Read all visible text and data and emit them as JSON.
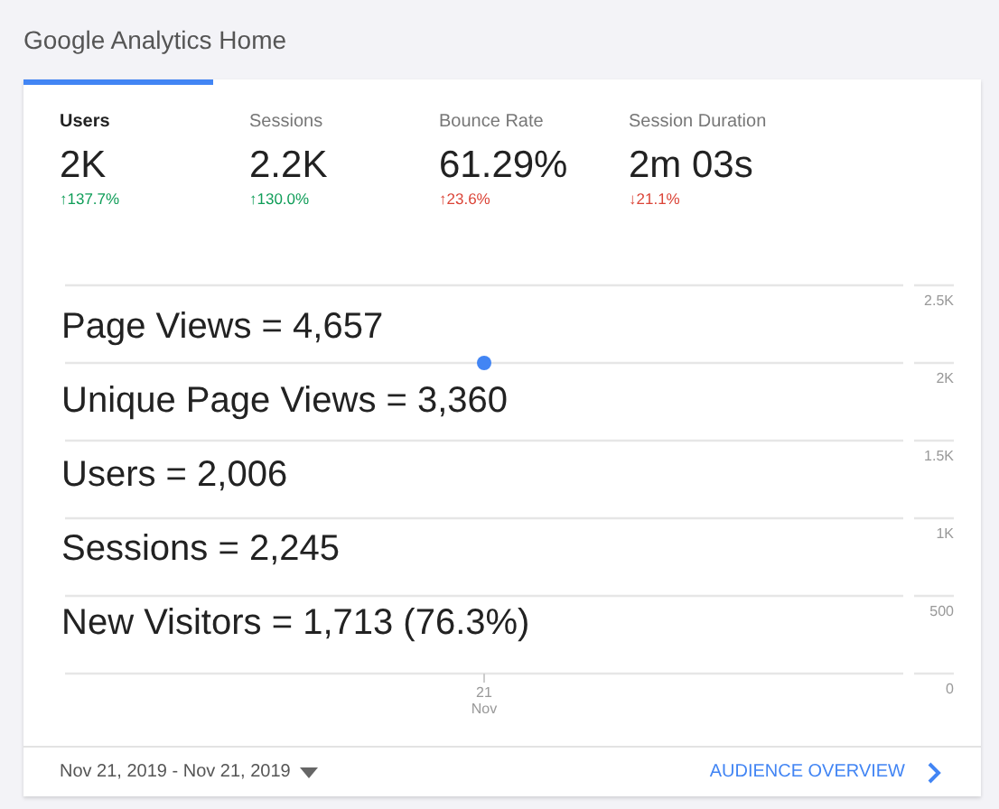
{
  "title": "Google Analytics Home",
  "metrics": [
    {
      "label": "Users",
      "value": "2K",
      "change": "↑137.7%",
      "color": "#0f9d58",
      "selected": true
    },
    {
      "label": "Sessions",
      "value": "2.2K",
      "change": "↑130.0%",
      "color": "#0f9d58",
      "selected": false
    },
    {
      "label": "Bounce Rate",
      "value": "61.29%",
      "change": "↑23.6%",
      "color": "#db4437",
      "selected": false
    },
    {
      "label": "Session Duration",
      "value": "2m 03s",
      "change": "↓21.1%",
      "color": "#db4437",
      "selected": false
    }
  ],
  "chart": {
    "chart_data": {
      "type": "line",
      "categories": [
        "21\nNov"
      ],
      "grid": true,
      "series": [
        {
          "color": "#4285f4",
          "marker": true,
          "values": [
            2000
          ]
        }
      ],
      "ylim": [
        0,
        2500
      ],
      "yticks": [
        {
          "value": 0,
          "label": "0"
        },
        {
          "value": 500,
          "label": "500"
        },
        {
          "value": 1000,
          "label": "1K"
        },
        {
          "value": 1500,
          "label": "1.5K"
        },
        {
          "value": 2000,
          "label": "2K"
        },
        {
          "value": 2500,
          "label": "2.5K"
        }
      ]
    }
  },
  "overlay": [
    "Page Views = 4,657",
    "Unique Page Views = 3,360",
    "Users = 2,006",
    "Sessions = 2,245",
    "New Visitors = 1,713 (76.3%)"
  ],
  "footer": {
    "date_range": "Nov 21, 2019 - Nov 21, 2019",
    "link": "AUDIENCE OVERVIEW"
  }
}
